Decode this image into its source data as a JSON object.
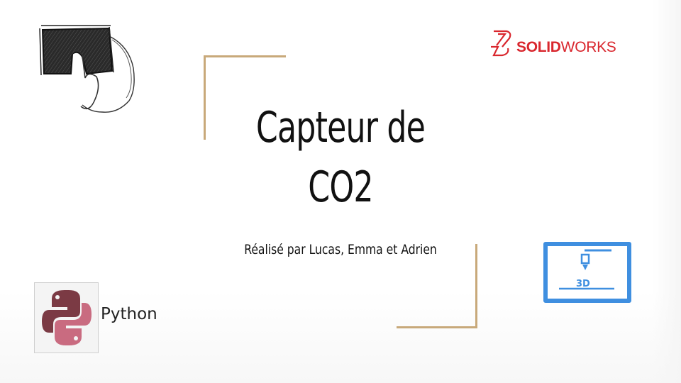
{
  "slide": {
    "title_line1": "Capteur de",
    "title_line2": "CO2",
    "subtitle": "Réalisé par Lucas, Emma et Adrien"
  },
  "logos": {
    "solidworks_part1": "SOLID",
    "solidworks_part2": "WORKS",
    "python_label": "Python",
    "printer_label": "3D"
  },
  "colors": {
    "accent_bracket": "#c8a97a",
    "solidworks_red": "#d9272e",
    "printer_blue": "#3f8fe0",
    "python_maroon": "#7b3a44",
    "python_pink": "#c96b80"
  },
  "icons": {
    "sketch": "hand-drawn-sensor-sketch-icon",
    "solidworks": "solidworks-logo-icon",
    "python": "python-logo-icon",
    "printer": "3d-printer-icon"
  }
}
